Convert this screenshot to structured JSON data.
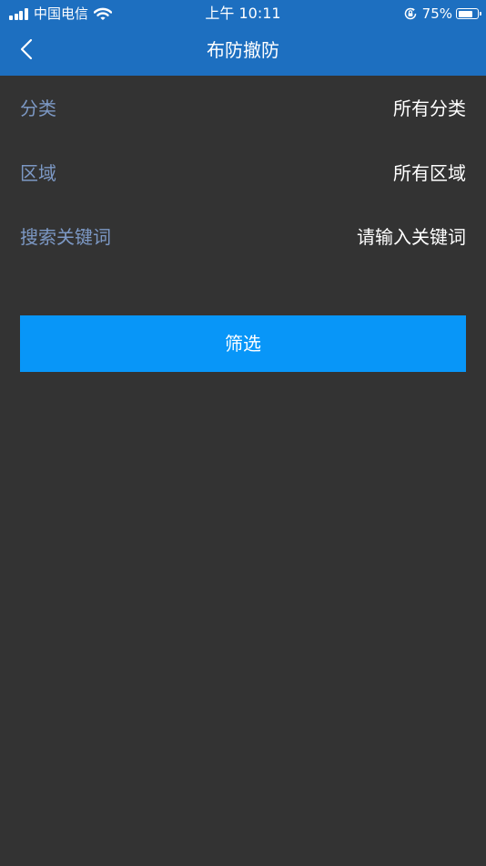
{
  "status_bar": {
    "carrier": "中国电信",
    "time": "上午 10:11",
    "battery_percent": "75%",
    "battery_level": 0.75,
    "icons": [
      "signal-icon",
      "wifi-icon",
      "orientation-lock-icon",
      "battery-icon"
    ]
  },
  "nav": {
    "back_icon": "chevron-left-icon",
    "title": "布防撤防"
  },
  "filters": {
    "category": {
      "label": "分类",
      "value": "所有分类"
    },
    "area": {
      "label": "区域",
      "value": "所有区域"
    },
    "keyword": {
      "label": "搜索关键词",
      "value": "",
      "placeholder": "请输入关键词"
    }
  },
  "actions": {
    "filter_button_label": "筛选"
  },
  "colors": {
    "header_bg": "#1d6fc0",
    "page_bg": "#333333",
    "label_color": "#7c98c4",
    "button_bg": "#0896f8"
  }
}
